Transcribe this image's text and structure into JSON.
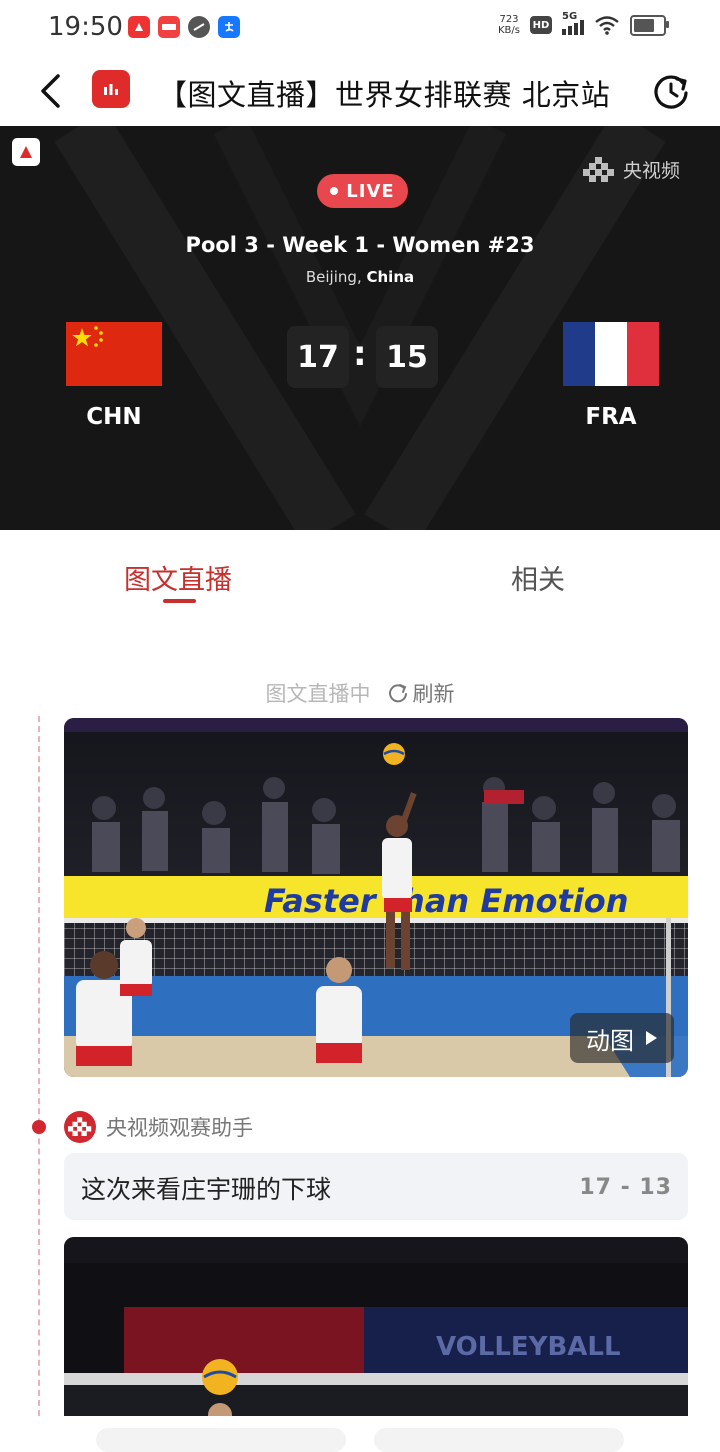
{
  "status_bar": {
    "time": "19:50",
    "app_icons": [
      "toutiao-app-icon",
      "news-app-icon",
      "browser-app-icon",
      "alipay-app-icon"
    ],
    "net_speed_value": "723",
    "net_speed_unit": "KB/s",
    "hd_label": "HD",
    "network_label": "5G",
    "battery_level": 0.62
  },
  "nav": {
    "title": "【图文直播】世界女排联赛 北京站"
  },
  "scoreboard": {
    "brand": "央视频",
    "live_label": "LIVE",
    "match_name": "Pool 3 - Week 1 - Women #23",
    "venue_city": "Beijing",
    "venue_country": "China",
    "home": {
      "code": "CHN",
      "score": "17"
    },
    "away": {
      "code": "FRA",
      "score": "15"
    },
    "separator": ":"
  },
  "tabs": [
    {
      "label": "图文直播",
      "active": true
    },
    {
      "label": "相关",
      "active": false
    }
  ],
  "feed": {
    "status_text": "图文直播中",
    "refresh_label": "刷新",
    "first_media": {
      "banner_text": "Faster than Emotion",
      "badge_label": "动图"
    },
    "post": {
      "author": "央视频观赛助手",
      "text": "这次来看庄宇珊的下球",
      "score": "17 - 13"
    },
    "second_media": {
      "banner_text": "VOLLEYBALL"
    }
  },
  "colors": {
    "accent": "#c8302d",
    "live": "#e8474d",
    "scoreboard_bg": "#161616"
  }
}
